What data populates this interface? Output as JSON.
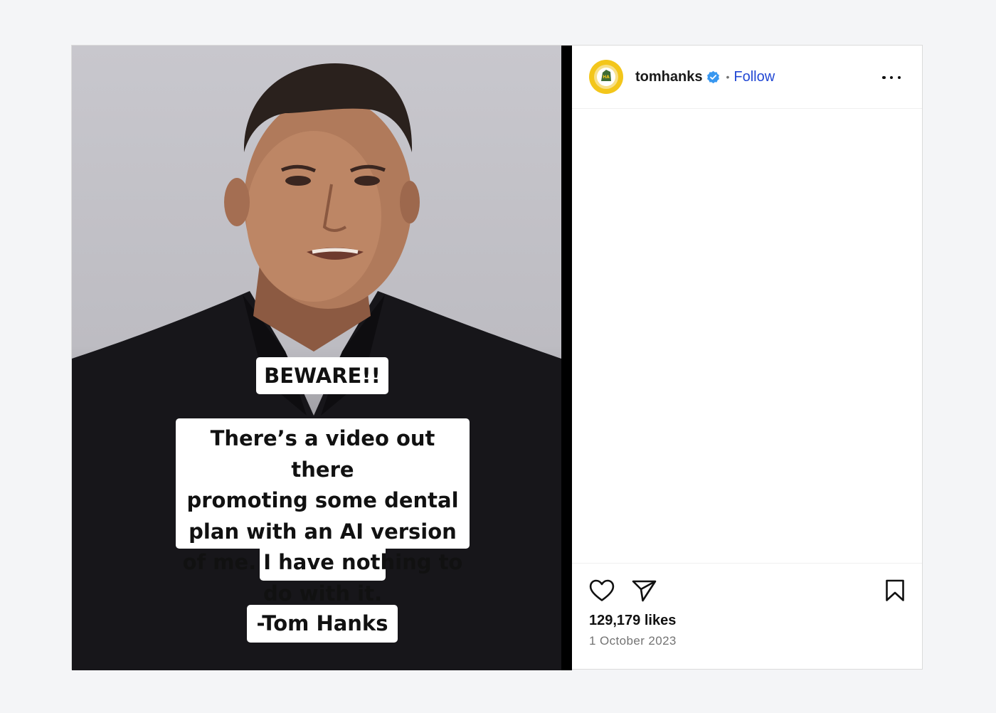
{
  "post": {
    "media": {
      "captions": {
        "beware": "BEWARE!!",
        "body": "There’s a video out there\npromoting some dental\nplan with an AI version\nof me.  I have nothing to\ndo with it.",
        "signature": "-Tom Hanks"
      }
    },
    "header": {
      "username": "tomhanks",
      "separator": "•",
      "follow_label": "Follow",
      "avatar_icon": "yellow-circle-badge",
      "verified_icon": "verified-badge-icon",
      "more_icon": "more-options-icon"
    },
    "footer": {
      "likes": "129,179 likes",
      "date": "1 October 2023",
      "like_icon": "heart-outline-icon",
      "share_icon": "paper-plane-icon",
      "save_icon": "bookmark-outline-icon"
    }
  },
  "colors": {
    "page_background": "#f4f5f7",
    "follow_link": "#2248d4",
    "verified_badge": "#3897f0",
    "avatar_ring": "#f3c61b"
  }
}
